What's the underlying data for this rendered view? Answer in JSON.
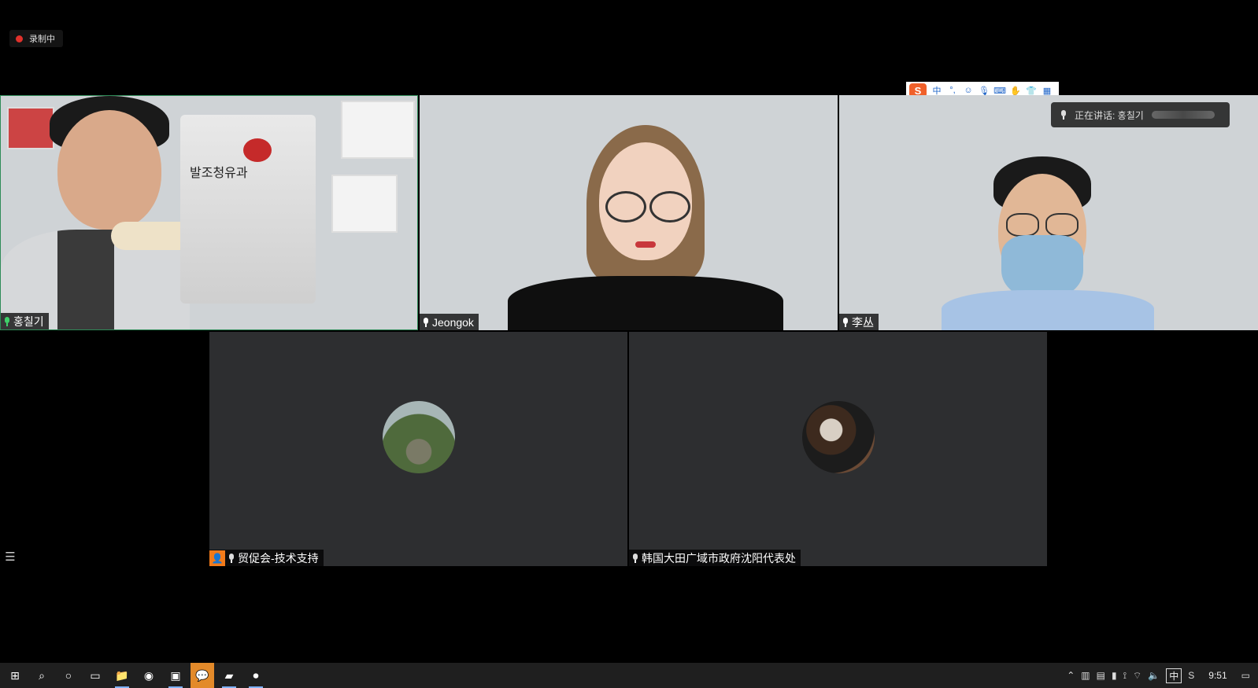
{
  "recording": {
    "label": "录制中"
  },
  "ime": {
    "logo": "S",
    "lang": "中"
  },
  "active_speaker": {
    "label": "正在讲话: 홍칠기"
  },
  "participants": [
    {
      "name": "홍칠기",
      "audio": "active"
    },
    {
      "name": "Jeongok",
      "audio": "on"
    },
    {
      "name": "李丛",
      "audio": "on"
    },
    {
      "name": "贸促会-技术支持",
      "audio": "muted",
      "host": true
    },
    {
      "name": "韩国大田广域市政府沈阳代表处",
      "audio": "muted"
    }
  ],
  "product_text": "발조청유과",
  "taskbar": {
    "ime_indicator": "中",
    "time": "9:51"
  },
  "colors": {
    "active_border": "#2e8b57",
    "host_badge": "#f27a1a",
    "recording": "#e0312b"
  }
}
